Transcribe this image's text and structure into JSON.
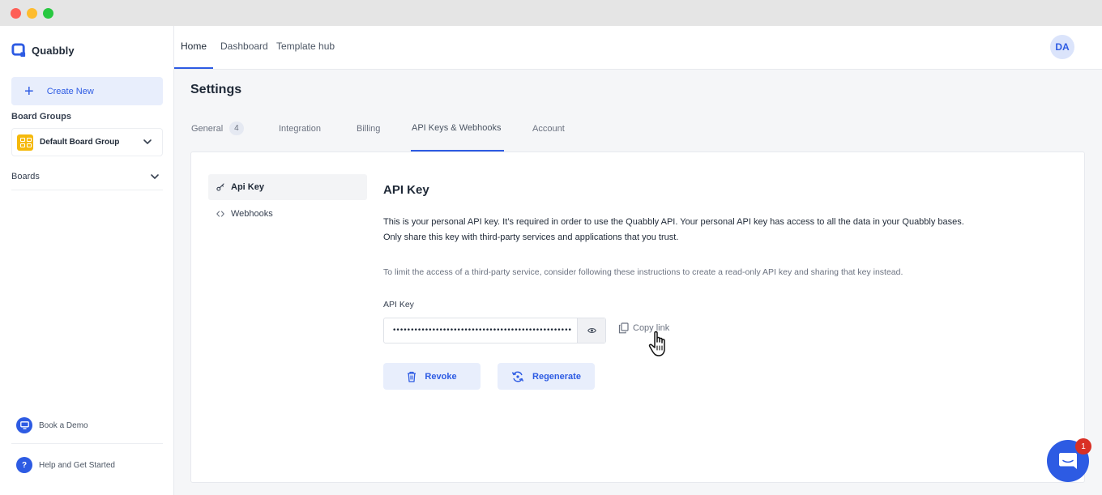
{
  "window": {
    "buttons": [
      "close",
      "minimize",
      "maximize"
    ]
  },
  "brand": {
    "name": "Quabbly",
    "color": "#2d5be3"
  },
  "sidebar": {
    "create_new": "Create New",
    "board_groups_label": "Board Groups",
    "board_group": {
      "name": "Default Board Group",
      "icon": "grid-icon"
    },
    "boards_label": "Boards",
    "bottom_items": [
      {
        "label": "Book a Demo",
        "icon": "monitor-icon"
      },
      {
        "label": "Help and Get Started",
        "icon": "question-icon"
      }
    ]
  },
  "topnav": {
    "items": [
      {
        "label": "Home",
        "active": true
      },
      {
        "label": "Dashboard",
        "active": false
      },
      {
        "label": "Template hub",
        "active": false
      }
    ],
    "avatar_initials": "DA"
  },
  "settings": {
    "title": "Settings",
    "tabs": [
      {
        "label": "General",
        "badge": "4"
      },
      {
        "label": "Integration"
      },
      {
        "label": "Billing"
      },
      {
        "label": "API Keys & Webhooks",
        "active": true
      },
      {
        "label": "Account"
      }
    ],
    "subnav": [
      {
        "label": "Api Key",
        "icon": "key-icon",
        "active": true
      },
      {
        "label": "Webhooks",
        "icon": "code-icon",
        "active": false
      }
    ],
    "content": {
      "title": "API Key",
      "desc_line1": "This is your personal API key. It’s required in order to use the Quabbly API. Your personal API key has access to all the data in your Quabbly bases.",
      "desc_line2": "Only share this key with third-party services and applications that you trust.",
      "note": "To limit the access of a third-party service, consider following these instructions to create a read-only API key and sharing that key instead.",
      "field_label": "API Key",
      "field_value": "••••••••••••••••••••••••••••••••••••••••••••••••••",
      "copy_link": "Copy link",
      "revoke": "Revoke",
      "regenerate": "Regenerate"
    }
  },
  "chat": {
    "badge": "1",
    "icon": "chat-icon"
  }
}
